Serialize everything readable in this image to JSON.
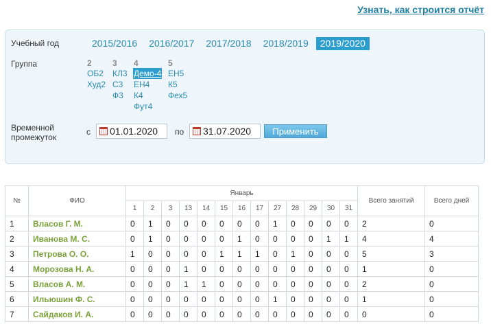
{
  "help_link": "Узнать, как строится отчёт",
  "filters": {
    "year_label": "Учебный год",
    "years": [
      "2015/2016",
      "2016/2017",
      "2017/2018",
      "2018/2019",
      "2019/2020"
    ],
    "active_year": "2019/2020",
    "group_label": "Группа",
    "groups": [
      {
        "head": "2",
        "items": [
          "ОБ2",
          "Худ2"
        ]
      },
      {
        "head": "3",
        "items": [
          "КЛ3",
          "С3",
          "Ф3"
        ]
      },
      {
        "head": "4",
        "items": [
          "Демо-4",
          "ЕН4",
          "К4",
          "Фут4"
        ]
      },
      {
        "head": "5",
        "items": [
          "ЕН5",
          "К5",
          "Фех5"
        ]
      }
    ],
    "active_group": "Демо-4",
    "period_label_1": "Временной",
    "period_label_2": "промежуток",
    "from_label": "с",
    "from_date": "01.01.2020",
    "to_label": "по",
    "to_date": "31.07.2020",
    "apply_label": "Применить"
  },
  "table": {
    "col_num": "№",
    "col_name": "ФИО",
    "month": "Январь",
    "days": [
      "1",
      "2",
      "3",
      "13",
      "14",
      "15",
      "16",
      "17",
      "27",
      "28",
      "29",
      "30",
      "31"
    ],
    "col_total_lessons": "Всего занятий",
    "col_total_days": "Всего дней",
    "rows": [
      {
        "n": "1",
        "name": "Власов Г. М.",
        "marks": [
          "0",
          "1",
          "0",
          "0",
          "0",
          "0",
          "0",
          "0",
          "1",
          "0",
          "0",
          "0",
          "0"
        ],
        "lessons": "2",
        "days": "0"
      },
      {
        "n": "2",
        "name": "Иванова М. С.",
        "marks": [
          "0",
          "1",
          "0",
          "0",
          "0",
          "0",
          "1",
          "0",
          "0",
          "0",
          "0",
          "1",
          "1"
        ],
        "lessons": "4",
        "days": "4"
      },
      {
        "n": "3",
        "name": "Петрова О. О.",
        "marks": [
          "1",
          "0",
          "0",
          "0",
          "0",
          "1",
          "1",
          "1",
          "0",
          "1",
          "0",
          "0",
          "0"
        ],
        "lessons": "5",
        "days": "3"
      },
      {
        "n": "4",
        "name": "Морозова Н. А.",
        "marks": [
          "0",
          "0",
          "0",
          "1",
          "0",
          "0",
          "0",
          "0",
          "0",
          "0",
          "0",
          "0",
          "0"
        ],
        "lessons": "1",
        "days": "0"
      },
      {
        "n": "5",
        "name": "Власов А. М.",
        "marks": [
          "0",
          "0",
          "0",
          "1",
          "1",
          "0",
          "0",
          "0",
          "0",
          "0",
          "0",
          "0",
          "0"
        ],
        "lessons": "2",
        "days": "0"
      },
      {
        "n": "6",
        "name": "Ильюшин Ф. С.",
        "marks": [
          "0",
          "0",
          "0",
          "0",
          "0",
          "0",
          "0",
          "0",
          "1",
          "0",
          "0",
          "0",
          "0"
        ],
        "lessons": "1",
        "days": "0"
      },
      {
        "n": "7",
        "name": "Сайдаков И. А.",
        "marks": [
          "0",
          "0",
          "0",
          "0",
          "0",
          "0",
          "0",
          "0",
          "0",
          "0",
          "0",
          "0",
          "0"
        ],
        "lessons": "0",
        "days": "0"
      }
    ]
  }
}
